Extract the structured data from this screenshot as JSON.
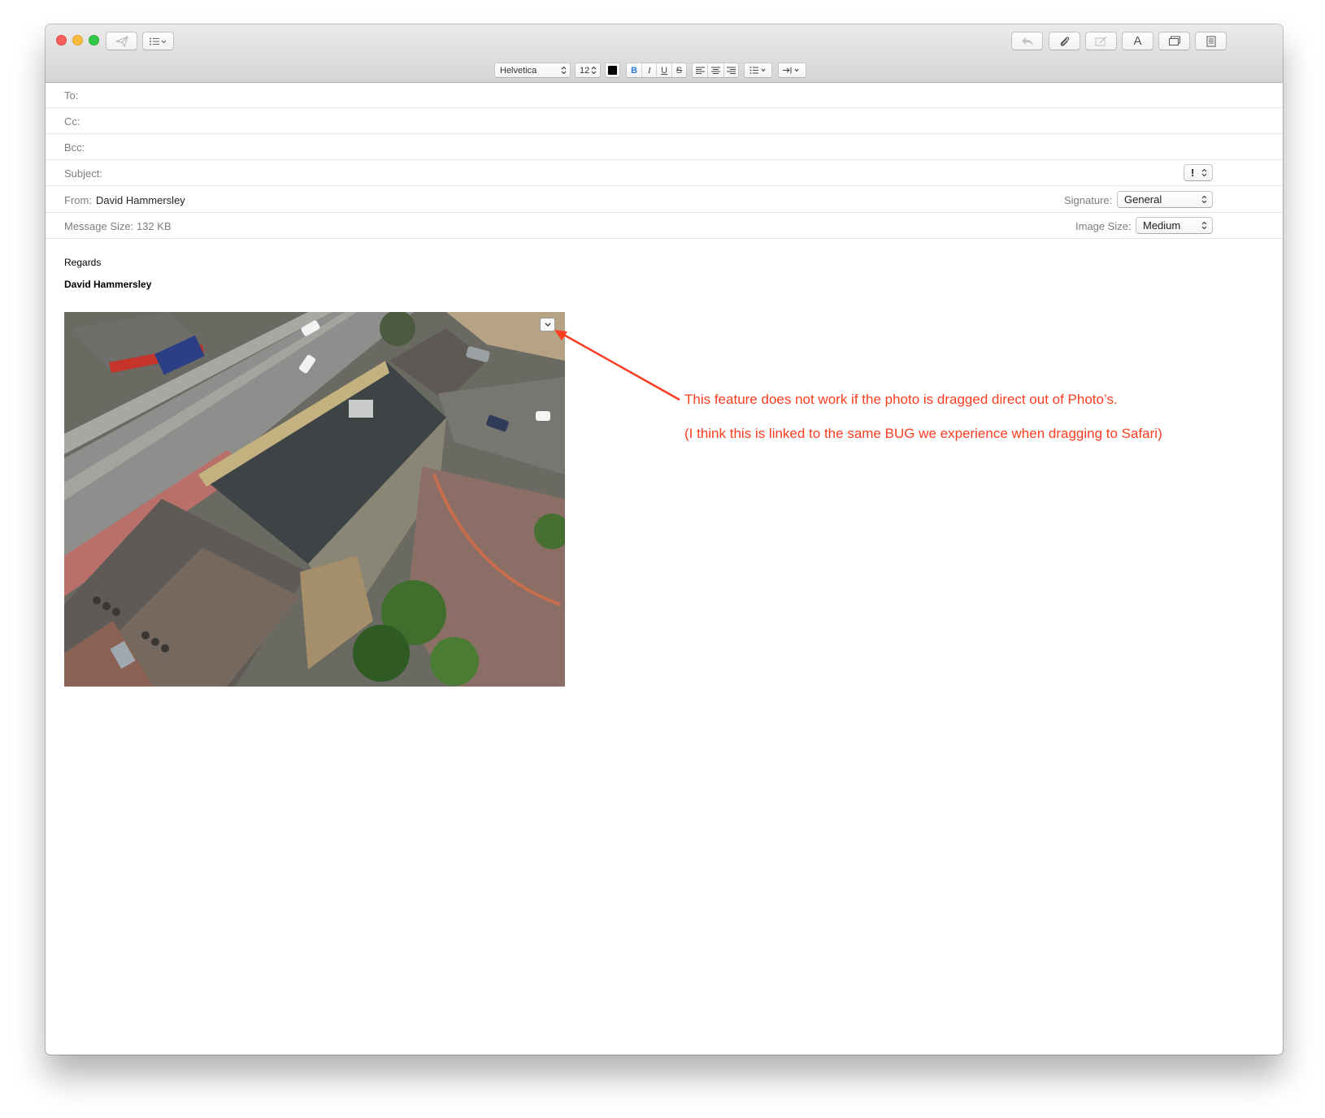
{
  "toolbar": {
    "send_icon": "paper-plane-icon",
    "header_fields_icon": "list-icon",
    "right_buttons": [
      "reply-icon",
      "paperclip-icon",
      "markup-icon",
      "font-icon",
      "photo-browser-icon",
      "stationery-icon"
    ],
    "font_button_label": "A"
  },
  "format_bar": {
    "font_family": "Helvetica",
    "font_size": "12",
    "text_color": "#000000",
    "bold": "B",
    "italic": "I",
    "underline": "U",
    "strikethrough": "S"
  },
  "headers": {
    "to_label": "To:",
    "cc_label": "Cc:",
    "bcc_label": "Bcc:",
    "subject_label": "Subject:",
    "priority_value": "!",
    "from_label": "From:",
    "from_value": "David Hammersley",
    "signature_label": "Signature:",
    "signature_value": "General",
    "message_size_label": "Message Size:",
    "message_size_value": "132 KB",
    "image_size_label": "Image Size:",
    "image_size_value": "Medium"
  },
  "body": {
    "regards": "Regards",
    "name": "David Hammersley",
    "photo_description": "aerial-street-photo"
  },
  "annotation": {
    "line1": "This feature does not work if the photo is dragged direct out of Photo’s.",
    "line2": "(I think this is linked to the same BUG we experience when dragging to Safari)",
    "color": "#fc3d21"
  }
}
